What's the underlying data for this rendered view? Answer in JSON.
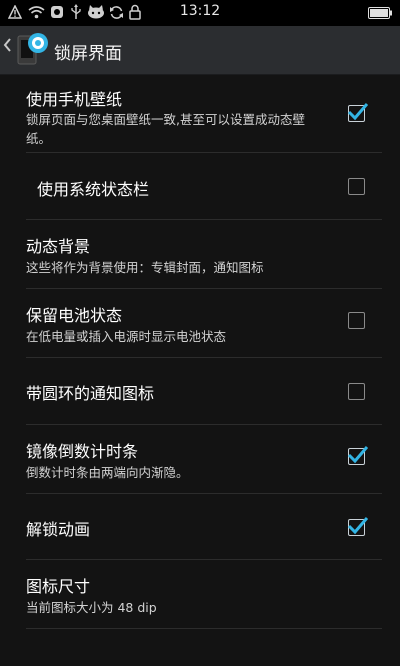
{
  "status_bar": {
    "time": "13:12",
    "icons": [
      "warning-icon",
      "wifi-icon",
      "cloud-icon",
      "usb-icon",
      "cat-icon",
      "sync-icon",
      "lock-icon",
      "battery-icon"
    ]
  },
  "header": {
    "title": "锁屏界面",
    "back_icon": "chevron-left-icon",
    "app_icon": "app-icon"
  },
  "settings": [
    {
      "title": "使用手机壁纸",
      "subtitle": "锁屏页面与您桌面壁纸一致,甚至可以设置成动态壁纸。",
      "checkbox": true,
      "checked": true
    },
    {
      "title": "使用系统状态栏",
      "subtitle": "",
      "checkbox": true,
      "checked": false
    },
    {
      "title": "动态背景",
      "subtitle": "这些将作为背景使用：专辑封面，通知图标",
      "checkbox": false,
      "checked": false
    },
    {
      "title": "保留电池状态",
      "subtitle": "在低电量或插入电源时显示电池状态",
      "checkbox": true,
      "checked": false
    },
    {
      "title": "带圆环的通知图标",
      "subtitle": "",
      "checkbox": true,
      "checked": false
    },
    {
      "title": "镜像倒数计时条",
      "subtitle": "倒数计时条由两端向内渐隐。",
      "checkbox": true,
      "checked": true
    },
    {
      "title": "解锁动画",
      "subtitle": "",
      "checkbox": true,
      "checked": true
    },
    {
      "title": "图标尺寸",
      "subtitle": "当前图标大小为 48 dip",
      "checkbox": false,
      "checked": false
    }
  ],
  "colors": {
    "accent": "#33b5e5",
    "check": "#33b5e5"
  }
}
